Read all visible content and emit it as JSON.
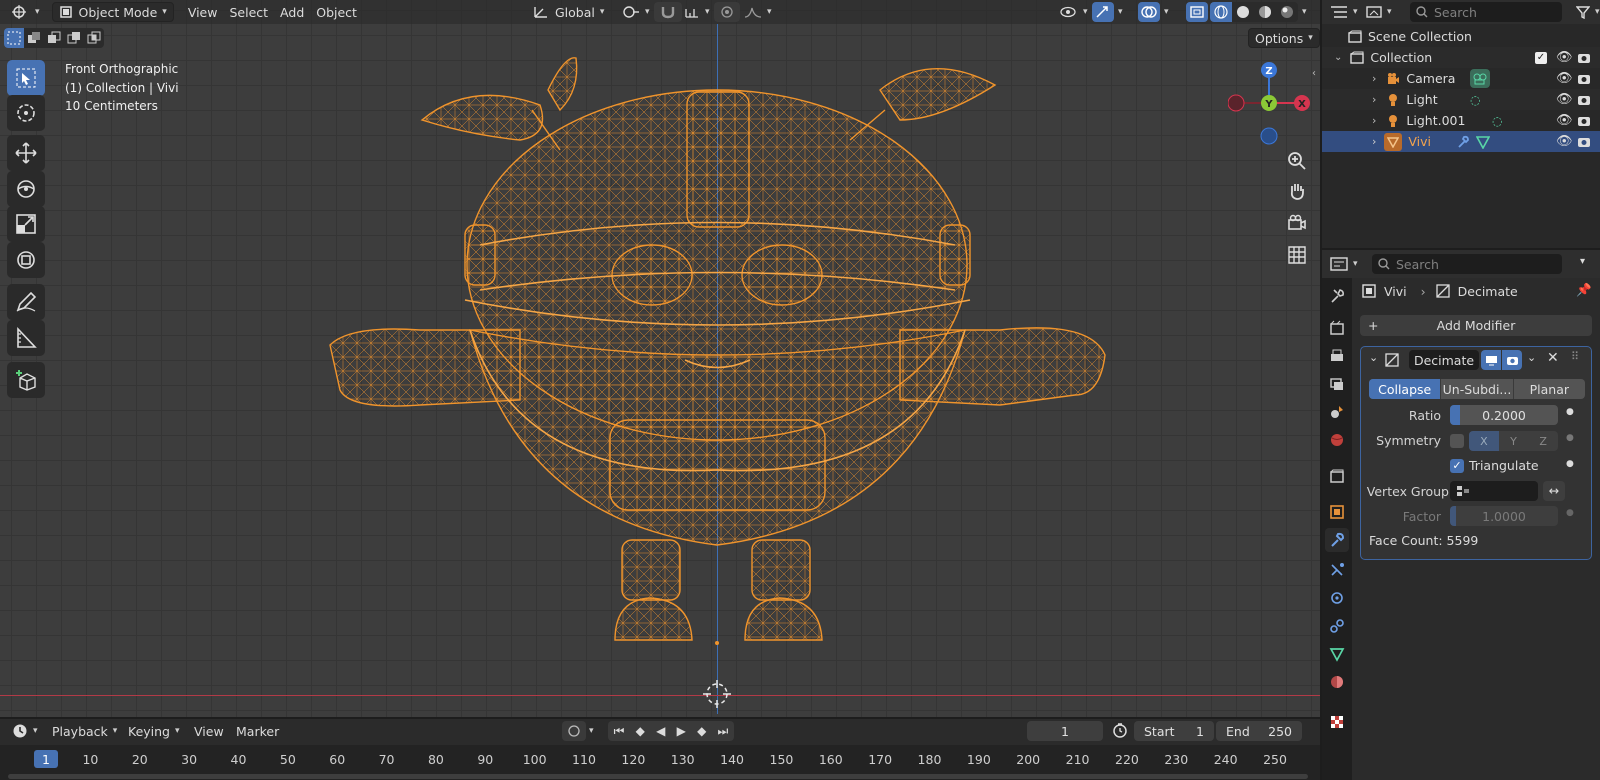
{
  "viewport": {
    "header": {
      "mode": "Object Mode",
      "menus": [
        "View",
        "Select",
        "Add",
        "Object"
      ],
      "orientation": "Global",
      "options_label": "Options"
    },
    "overlay": {
      "line1": "Front Orthographic",
      "line2": "(1) Collection | Vivi",
      "line3": "10 Centimeters"
    },
    "gizmo": {
      "z": "Z",
      "y": "Y",
      "x": "X"
    },
    "colors": {
      "wire": "#f0942c",
      "background": "#3d3d3d",
      "accent": "#4772b3"
    }
  },
  "outliner": {
    "search_placeholder": "Search",
    "scene_label": "Scene Collection",
    "collection_label": "Collection",
    "items": [
      {
        "name": "Camera",
        "icon": "camera-icon"
      },
      {
        "name": "Light",
        "icon": "light-icon"
      },
      {
        "name": "Light.001",
        "icon": "light-icon"
      },
      {
        "name": "Vivi",
        "icon": "mesh-icon",
        "selected": true
      }
    ]
  },
  "properties": {
    "search_placeholder": "Search",
    "breadcrumb_object": "Vivi",
    "breadcrumb_modifier": "Decimate",
    "add_modifier": "Add Modifier",
    "modifier_name": "Decimate",
    "tabs": [
      "Collapse",
      "Un-Subdi...",
      "Planar"
    ],
    "ratio_label": "Ratio",
    "ratio_value": "0.2000",
    "ratio_fraction": 0.2,
    "symmetry_label": "Symmetry",
    "symmetry_axes": [
      "X",
      "Y",
      "Z"
    ],
    "triangulate_label": "Triangulate",
    "vertex_group_label": "Vertex Group",
    "factor_label": "Factor",
    "factor_value": "1.0000",
    "face_count": "Face Count: 5599"
  },
  "timeline": {
    "menus": [
      "Playback",
      "Keying",
      "View",
      "Marker"
    ],
    "current_frame": "1",
    "start_label": "Start",
    "start_value": "1",
    "end_label": "End",
    "end_value": "250",
    "ruler": [
      "1",
      "10",
      "20",
      "30",
      "40",
      "50",
      "60",
      "70",
      "80",
      "90",
      "100",
      "110",
      "120",
      "130",
      "140",
      "150",
      "160",
      "170",
      "180",
      "190",
      "200",
      "210",
      "220",
      "230",
      "240",
      "250"
    ]
  }
}
